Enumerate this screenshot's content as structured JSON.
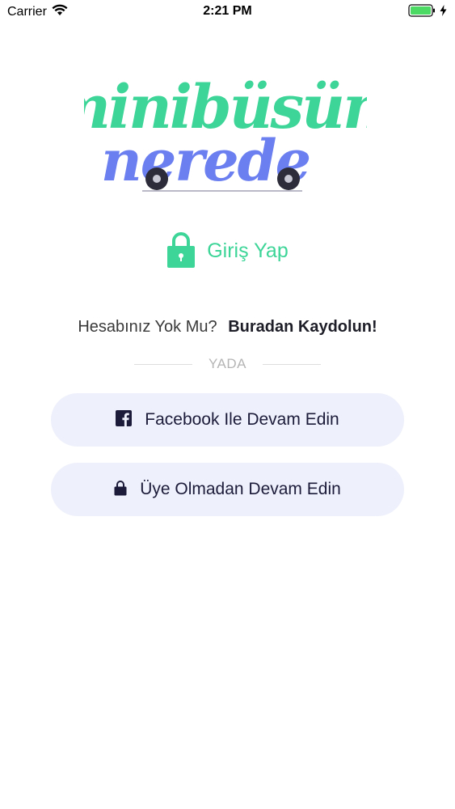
{
  "status_bar": {
    "carrier": "Carrier",
    "time": "2:21 PM"
  },
  "logo": {
    "line1": "minibüsüm",
    "line2": "nerede",
    "color_line1": "#3dd598",
    "color_line2": "#6b7ff0"
  },
  "login": {
    "label": "Giriş Yap",
    "icon": "lock-icon",
    "color": "#3dd598"
  },
  "register": {
    "question": "Hesabınız Yok Mu?",
    "link": "Buradan Kaydolun!"
  },
  "divider": {
    "text": "YADA"
  },
  "buttons": {
    "facebook": {
      "label": "Facebook Ile Devam Edin",
      "icon": "facebook-icon"
    },
    "guest": {
      "label": "Üye Olmadan Devam Edin",
      "icon": "lock-icon"
    }
  }
}
